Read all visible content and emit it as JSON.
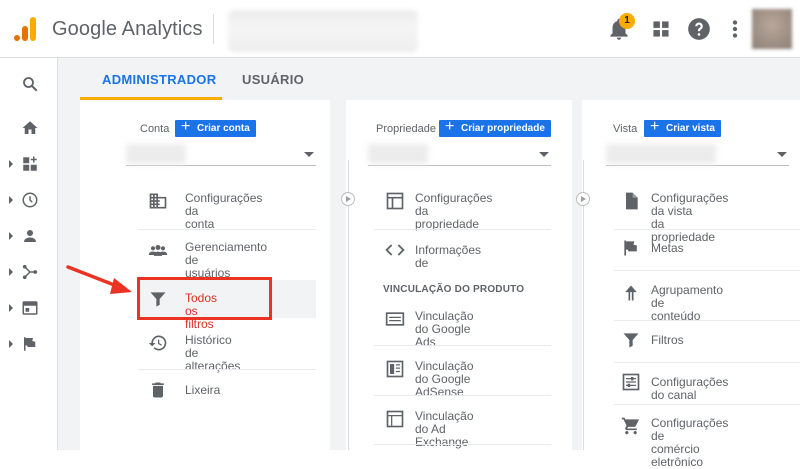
{
  "header": {
    "app_title": "Google Analytics",
    "notification_count": "1"
  },
  "tabs": {
    "admin": "ADMINISTRADOR",
    "user": "USUÁRIO"
  },
  "account": {
    "label": "Conta",
    "create_button": "Criar conta",
    "items": [
      {
        "icon": "building-icon",
        "label_line1": "Configurações da",
        "label_line2": "conta"
      },
      {
        "icon": "people-icon",
        "label_line1": "Gerenciamento de",
        "label_line2": "usuários"
      },
      {
        "icon": "filter-icon",
        "label_line1": "Todos os filtros",
        "label_line2": ""
      },
      {
        "icon": "history-icon",
        "label_line1": "Histórico de",
        "label_line2": "alterações"
      },
      {
        "icon": "trash-icon",
        "label_line1": "Lixeira",
        "label_line2": ""
      }
    ]
  },
  "property": {
    "label": "Propriedade",
    "create_button": "Criar propriedade",
    "items": [
      {
        "icon": "property-settings-icon",
        "label_line1": "Configurações da",
        "label_line2": "propriedade"
      },
      {
        "icon": "code-icon",
        "label_line1": "Informações de",
        "label_line2": ""
      }
    ],
    "section_header": "VINCULAÇÃO DO PRODUTO",
    "links": [
      {
        "icon": "google-ads-icon",
        "label_line1": "Vinculação do Google",
        "label_line2": "Ads"
      },
      {
        "icon": "adsense-icon",
        "label_line1": "Vinculação do Google",
        "label_line2": "AdSense"
      },
      {
        "icon": "ad-exchange-icon",
        "label_line1": "Vinculação do Ad",
        "label_line2": "Exchange"
      }
    ]
  },
  "view": {
    "label": "Vista",
    "create_button": "Criar vista",
    "items": [
      {
        "icon": "document-icon",
        "label_line1": "Configurações da vista",
        "label_line2": "da propriedade"
      },
      {
        "icon": "flag-icon",
        "label_line1": "Metas",
        "label_line2": ""
      },
      {
        "icon": "grouping-icon",
        "label_line1": "Agrupamento de",
        "label_line2": "conteúdo"
      },
      {
        "icon": "filter-icon",
        "label_line1": "Filtros",
        "label_line2": ""
      },
      {
        "icon": "channel-icon",
        "label_line1": "Configurações do canal",
        "label_line2": ""
      },
      {
        "icon": "cart-icon",
        "label_line1": "Configurações de",
        "label_line2": "comércio eletrônico"
      }
    ]
  },
  "colors": {
    "accent_blue": "#1a73e8",
    "highlight_red": "#ea3323",
    "tab_underline": "#f9ab00"
  }
}
